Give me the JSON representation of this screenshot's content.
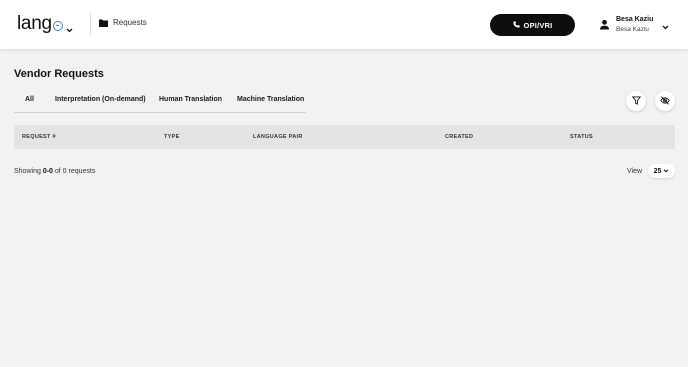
{
  "header": {
    "logo_text": "lang",
    "breadcrumb_label": "Requests",
    "opi_button_label": "OPI/VRI",
    "user_name": "Besa Kaziu",
    "user_sub": "Besa Kaziu"
  },
  "main": {
    "title": "Vendor Requests",
    "tabs": [
      {
        "label": "All"
      },
      {
        "label": "Interpretation (On-demand)"
      },
      {
        "label": "Human Translation"
      },
      {
        "label": "Machine Translation"
      }
    ],
    "columns": [
      "REQUEST #",
      "TYPE",
      "LANGUAGE PAIR",
      "CREATED",
      "STATUS"
    ],
    "showing_prefix": "Showing",
    "showing_range": "0-0",
    "showing_suffix": "of 0 requests",
    "view_label": "View",
    "page_size": "25"
  },
  "colors": {
    "accent": "#3a86d6",
    "button_bg": "#0d0d0d",
    "page_bg": "#f2f2f2",
    "table_header_bg": "#e4e4e4"
  },
  "icons": {
    "breadcrumb": "folder-icon",
    "opi": "phone-icon",
    "user": "person-icon",
    "filter": "filter-icon",
    "hide": "eye-off-icon"
  }
}
